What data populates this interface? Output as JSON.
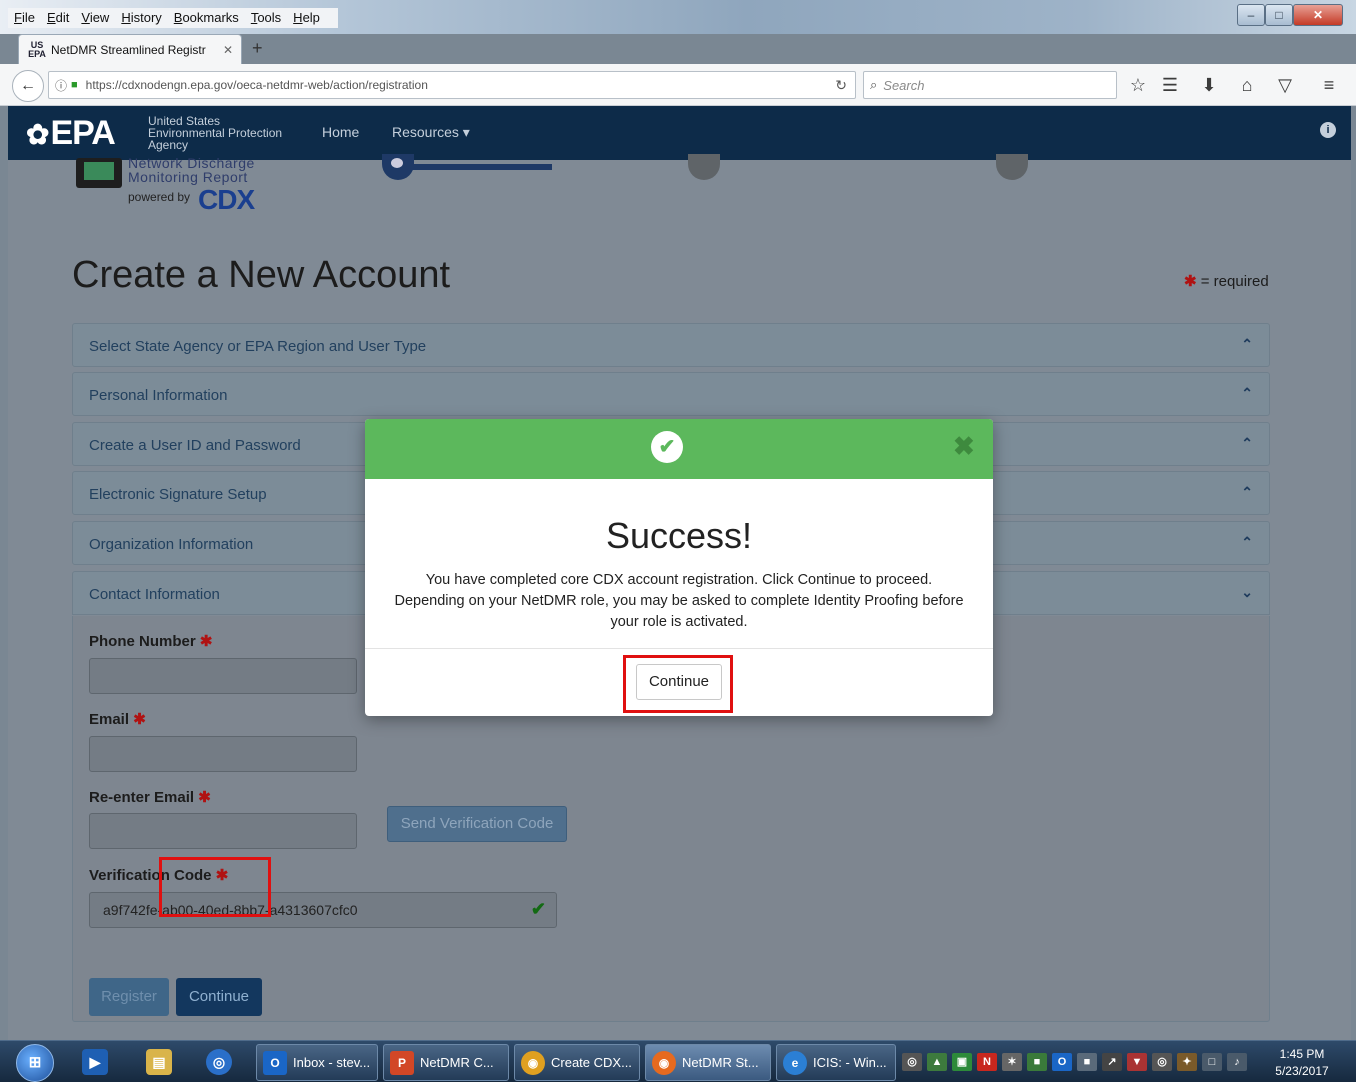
{
  "browser": {
    "menu": [
      "File",
      "Edit",
      "View",
      "History",
      "Bookmarks",
      "Tools",
      "Help"
    ],
    "tab_title": "NetDMR Streamlined Registr",
    "tab_favicon": "US EPA",
    "url": "https://cdxnodengn.epa.gov/oeca-netdmr-web/action/registration",
    "search_placeholder": "Search"
  },
  "header": {
    "logo": "EPA",
    "agency_line1": "United States",
    "agency_line2": "Environmental Protection",
    "agency_line3": "Agency",
    "nav_home": "Home",
    "nav_resources": "Resources ▾"
  },
  "brand": {
    "line1": "Network Discharge",
    "line2": "Monitoring Report",
    "powered_by": "powered by",
    "cdx": "CDX"
  },
  "page": {
    "title": "Create a New Account",
    "required_note": "= required",
    "panels": [
      "Select State Agency or EPA Region and User Type",
      "Personal Information",
      "Create a User ID and Password",
      "Electronic Signature Setup",
      "Organization Information",
      "Contact Information"
    ],
    "fields": {
      "phone": "Phone Number",
      "email": "Email",
      "reenter_email": "Re-enter Email",
      "verification_code": "Verification Code",
      "verification_value": "a9f742fe-ab00-40ed-8bb7-a4313607cfc0"
    },
    "send_code": "Send Verification Code",
    "register": "Register",
    "continue": "Continue"
  },
  "modal": {
    "title": "Success!",
    "line1": "You have completed core CDX account registration. Click Continue to proceed.",
    "line2": "Depending on your NetDMR role, you may be asked to complete Identity Proofing before your role is activated.",
    "continue": "Continue"
  },
  "taskbar": {
    "items": [
      "Inbox - stev...",
      "NetDMR C...",
      "Create CDX...",
      "NetDMR St...",
      "ICIS: - Win..."
    ],
    "time": "1:45 PM",
    "date": "5/23/2017"
  },
  "colors": {
    "epa_header": "#0d2b49",
    "success_green": "#5cb85c",
    "highlight_red": "#e01010"
  }
}
